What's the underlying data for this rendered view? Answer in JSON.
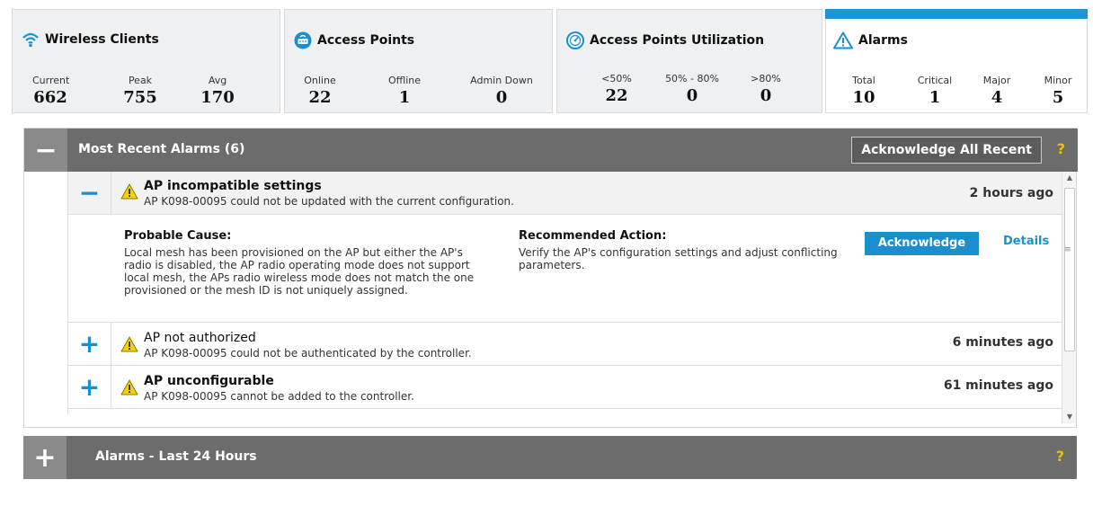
{
  "tiles": {
    "wireless_clients": {
      "title": "Wireless Clients",
      "icon": "wifi-icon",
      "stats": [
        {
          "label": "Current",
          "value": "662"
        },
        {
          "label": "Peak",
          "value": "755"
        },
        {
          "label": "Avg",
          "value": "170"
        }
      ]
    },
    "access_points": {
      "title": "Access Points",
      "icon": "access-point-icon",
      "stats": [
        {
          "label": "Online",
          "value": "22"
        },
        {
          "label": "Offline",
          "value": "1"
        },
        {
          "label": "Admin Down",
          "value": "0"
        }
      ]
    },
    "ap_utilization": {
      "title": "Access Points Utilization",
      "icon": "gauge-icon",
      "stats": [
        {
          "label": "<50%",
          "value": "22"
        },
        {
          "label": "50% - 80%",
          "value": "0"
        },
        {
          "label": ">80%",
          "value": "0"
        }
      ]
    },
    "alarms": {
      "title": "Alarms",
      "icon": "warning-triangle-icon",
      "accent": "#1a96d4",
      "stats": [
        {
          "label": "Total",
          "value": "10"
        },
        {
          "label": "Critical",
          "value": "1"
        },
        {
          "label": "Major",
          "value": "4"
        },
        {
          "label": "Minor",
          "value": "5"
        }
      ]
    }
  },
  "recent_alarms": {
    "title": "Most Recent Alarms (6)",
    "toggle": "−",
    "ack_all_label": "Acknowledge All Recent",
    "help": "?",
    "items": [
      {
        "toggle": "−",
        "title": "AP incompatible settings",
        "desc": "AP K098-00095 could not be updated with the current configuration.",
        "time": "2 hours ago",
        "probable_cause_heading": "Probable Cause:",
        "probable_cause": "Local mesh has been provisioned on the AP but either the AP's radio is disabled, the AP radio operating mode does not support local mesh, the APs radio wireless mode does not match the one provisioned or the mesh ID is not uniquely assigned.",
        "recommended_heading": "Recommended Action:",
        "recommended": "Verify the AP's configuration settings and adjust conflicting parameters.",
        "ack_label": "Acknowledge",
        "details_label": "Details"
      },
      {
        "toggle": "+",
        "title": "AP not authorized",
        "desc": "AP K098-00095 could not be authenticated by the controller.",
        "time": "6 minutes ago"
      },
      {
        "toggle": "+",
        "title": "AP unconfigurable",
        "desc": "AP K098-00095 cannot be added to the controller.",
        "time": "61 minutes ago"
      }
    ]
  },
  "last24": {
    "title": "Alarms - Last 24 Hours",
    "toggle": "+",
    "help": "?"
  },
  "colors": {
    "accent": "#1a8fd0",
    "header_bg": "#6c6c6c",
    "warning": "#f0c000"
  }
}
